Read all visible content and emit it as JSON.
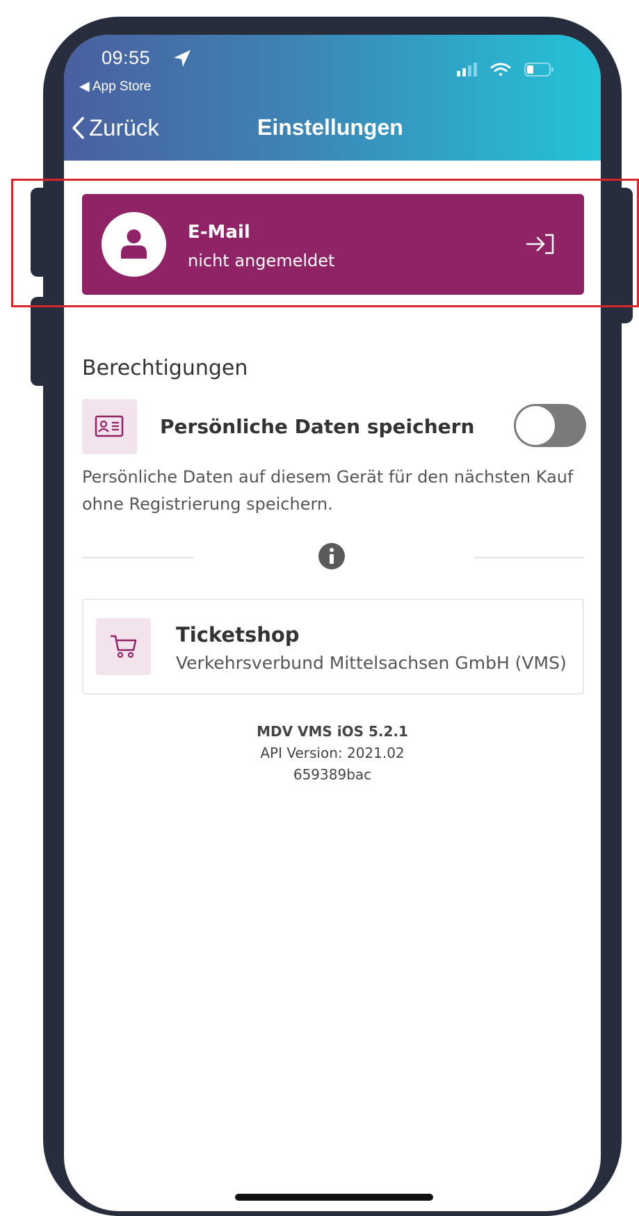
{
  "status_bar": {
    "time": "09:55",
    "back_app": "◀ App Store",
    "icons": [
      "location-arrow-icon",
      "signal-icon",
      "wifi-icon",
      "battery-icon"
    ]
  },
  "nav": {
    "back_label": "Zurück",
    "title": "Einstellungen"
  },
  "account": {
    "title": "E-Mail",
    "status": "nicht angemeldet",
    "color": "#8f2366"
  },
  "permissions": {
    "section_title": "Berechtigungen",
    "item_label": "Persönliche Daten speichern",
    "toggle_on": false,
    "description": "Persönliche Daten auf diesem Gerät für den nächsten Kauf ohne Registrierung speichern."
  },
  "shop": {
    "title": "Ticketshop",
    "subtitle": "Verkehrsverbund Mittelsachsen GmbH (VMS)"
  },
  "version": {
    "app": "MDV VMS iOS 5.2.1",
    "api": "API Version: 2021.02",
    "build": "659389bac"
  },
  "colors": {
    "header_gradient_start": "#4a5fa0",
    "header_gradient_end": "#23c3d8",
    "accent": "#8f2366",
    "highlight_box": "#d8262a",
    "frame": "#272d3c"
  }
}
